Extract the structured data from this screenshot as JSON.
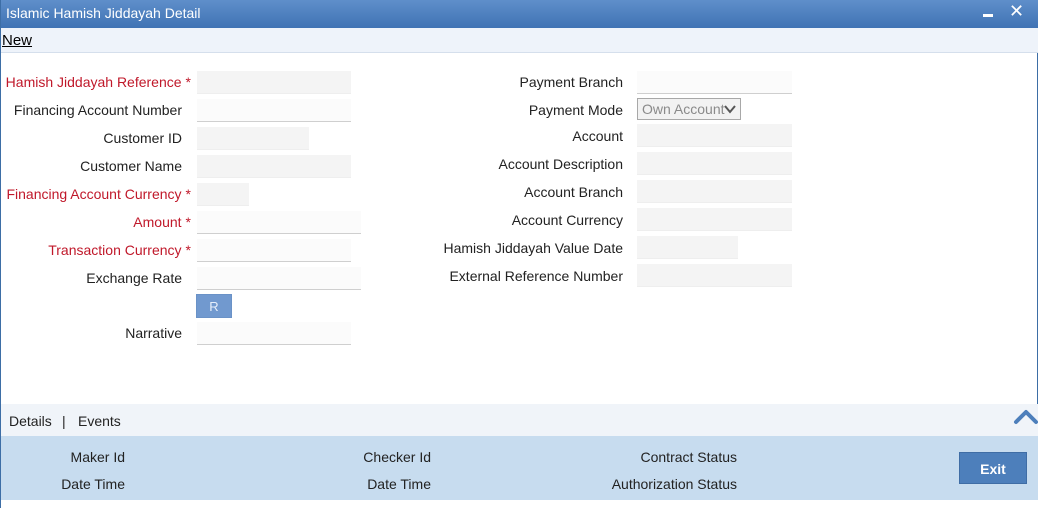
{
  "window": {
    "title": "Islamic Hamish Jiddayah Detail",
    "close_glyph": "✕"
  },
  "menu": {
    "new_label": "New"
  },
  "left_form": {
    "hamish_reference": {
      "label": "Hamish Jiddayah Reference",
      "required": "*",
      "value": ""
    },
    "financing_account_number": {
      "label": "Financing Account Number",
      "value": ""
    },
    "customer_id": {
      "label": "Customer ID",
      "value": ""
    },
    "customer_name": {
      "label": "Customer Name",
      "value": ""
    },
    "financing_account_currency": {
      "label": "Financing Account Currency",
      "required": "*",
      "value": ""
    },
    "amount": {
      "label": "Amount",
      "required": "*",
      "value": ""
    },
    "transaction_currency": {
      "label": "Transaction Currency",
      "required": "*",
      "value": ""
    },
    "exchange_rate": {
      "label": "Exchange Rate",
      "value": ""
    },
    "r_button_label": "R",
    "narrative": {
      "label": "Narrative",
      "value": ""
    }
  },
  "right_form": {
    "payment_branch": {
      "label": "Payment Branch",
      "value": ""
    },
    "payment_mode": {
      "label": "Payment Mode",
      "selected": "Own Account"
    },
    "account": {
      "label": "Account",
      "value": ""
    },
    "account_description": {
      "label": "Account Description",
      "value": ""
    },
    "account_branch": {
      "label": "Account Branch",
      "value": ""
    },
    "account_currency": {
      "label": "Account Currency",
      "value": ""
    },
    "value_date": {
      "label": "Hamish Jiddayah Value Date",
      "value": ""
    },
    "external_reference": {
      "label": "External Reference Number",
      "value": ""
    }
  },
  "tabs": {
    "details": "Details",
    "separator": "|",
    "events": "Events"
  },
  "footer": {
    "maker_id": "Maker Id",
    "maker_date_time": "Date Time",
    "checker_id": "Checker Id",
    "checker_date_time": "Date Time",
    "contract_status": "Contract Status",
    "authorization_status": "Authorization Status",
    "exit_label": "Exit"
  },
  "colors": {
    "titlebar": "#4a7fc1",
    "required_label": "#c0182a",
    "footer_bg": "#c7dcef",
    "exit_button": "#4d7fbb"
  },
  "icons": {
    "minimize": "minimize-icon",
    "close": "close-icon",
    "dropdown": "chevron-down-icon",
    "collapse": "chevron-up-icon"
  }
}
